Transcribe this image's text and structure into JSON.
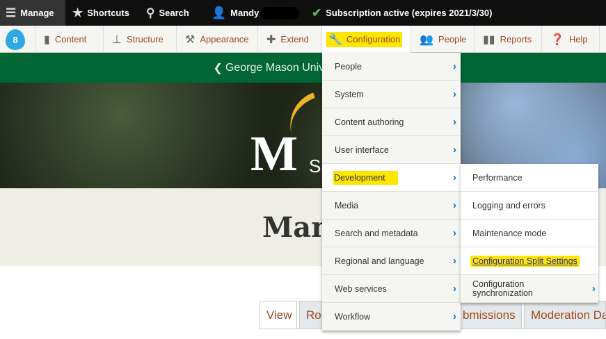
{
  "toolbar": {
    "manage": "Manage",
    "shortcuts": "Shortcuts",
    "search": "Search",
    "user": "Mandy",
    "subscription": "Subscription active (expires 2021/3/30)"
  },
  "nav": {
    "items": [
      {
        "label": "Content",
        "icon": "file-icon"
      },
      {
        "label": "Structure",
        "icon": "sitemap-icon"
      },
      {
        "label": "Appearance",
        "icon": "brush-icon"
      },
      {
        "label": "Extend",
        "icon": "puzzle-icon"
      },
      {
        "label": "Configuration",
        "icon": "wrench-icon"
      },
      {
        "label": "People",
        "icon": "people-icon"
      },
      {
        "label": "Reports",
        "icon": "chart-icon"
      },
      {
        "label": "Help",
        "icon": "help-icon"
      }
    ]
  },
  "site": {
    "back_link": "George Mason University",
    "logo_partial": "Si",
    "title_partial": "Man"
  },
  "tabs": [
    "View",
    "Rol",
    "bmissions",
    "Moderation Da"
  ],
  "config_menu": [
    "People",
    "System",
    "Content authoring",
    "User interface",
    "Development",
    "Media",
    "Search and metadata",
    "Regional and language",
    "Web services",
    "Workflow"
  ],
  "dev_submenu": [
    "Performance",
    "Logging and errors",
    "Maintenance mode",
    "Configuration Split Settings",
    "Configuration synchronization"
  ],
  "colors": {
    "highlight": "#ffe600",
    "green": "#006633",
    "link": "#9b4a1d",
    "chevron": "#0074bd"
  }
}
